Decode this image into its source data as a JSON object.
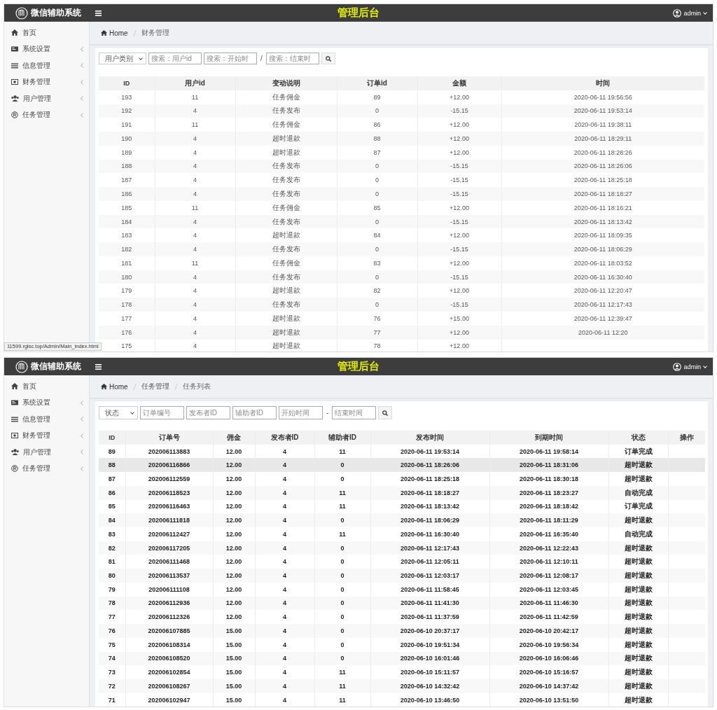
{
  "screens": [
    {
      "header": {
        "logo_text": "微信辅助系统",
        "title": "管理后台",
        "user": "admin"
      },
      "sidebar": [
        {
          "label": "首页",
          "expandable": false
        },
        {
          "label": "系统设置",
          "expandable": true
        },
        {
          "label": "信息管理",
          "expandable": true
        },
        {
          "label": "财务管理",
          "expandable": true
        },
        {
          "label": "用户管理",
          "expandable": true
        },
        {
          "label": "任务管理",
          "expandable": true
        }
      ],
      "breadcrumb": [
        "Home",
        "财务管理"
      ],
      "filters": [
        {
          "kind": "select",
          "label": "用户类别"
        },
        {
          "kind": "input",
          "placeholder": "搜索：用户id"
        },
        {
          "kind": "input",
          "placeholder": "搜索：开始时"
        },
        {
          "kind": "separator",
          "label": "/"
        },
        {
          "kind": "input",
          "placeholder": "搜索：结束时"
        },
        {
          "kind": "search"
        }
      ],
      "table": {
        "columns": [
          "ID",
          "用户id",
          "变动说明",
          "订单id",
          "金额",
          "时间"
        ],
        "rows": [
          [
            "193",
            "11",
            "任务佣金",
            "89",
            "+12.00",
            "2020-06-11 19:56:56"
          ],
          [
            "192",
            "4",
            "任务发布",
            "0",
            "-15.15",
            "2020-06-11 19:53:14"
          ],
          [
            "191",
            "11",
            "任务佣金",
            "86",
            "+12.00",
            "2020-06-11 19:38:11"
          ],
          [
            "190",
            "4",
            "超时退款",
            "88",
            "+12.00",
            "2020-06-11 18:29:11"
          ],
          [
            "189",
            "4",
            "超时退款",
            "87",
            "+12.00",
            "2020-06-11 18:28:26"
          ],
          [
            "188",
            "4",
            "任务发布",
            "0",
            "-15.15",
            "2020-06-11 18:26:06"
          ],
          [
            "187",
            "4",
            "任务发布",
            "0",
            "-15.15",
            "2020-06-11 18:25:18"
          ],
          [
            "186",
            "4",
            "任务发布",
            "0",
            "-15.15",
            "2020-06-11 18:18:27"
          ],
          [
            "185",
            "11",
            "任务佣金",
            "85",
            "+12.00",
            "2020-06-11 18:16:21"
          ],
          [
            "184",
            "4",
            "任务发布",
            "0",
            "-15.15",
            "2020-06-11 18:13:42"
          ],
          [
            "183",
            "4",
            "超时退款",
            "84",
            "+12.00",
            "2020-06-11 18:09:35"
          ],
          [
            "182",
            "4",
            "任务发布",
            "0",
            "-15.15",
            "2020-06-11 18:06:29"
          ],
          [
            "181",
            "11",
            "任务佣金",
            "83",
            "+12.00",
            "2020-06-11 18:03:52"
          ],
          [
            "180",
            "4",
            "任务发布",
            "0",
            "-15.15",
            "2020-06-11 16:30:40"
          ],
          [
            "179",
            "4",
            "超时退款",
            "82",
            "+12.00",
            "2020-06-11 12:20:47"
          ],
          [
            "178",
            "4",
            "任务发布",
            "0",
            "-15.15",
            "2020-06-11 12:17:43"
          ],
          [
            "177",
            "4",
            "超时退款",
            "76",
            "+15.00",
            "2020-06-11 12:39:47"
          ],
          [
            "176",
            "4",
            "超时退款",
            "77",
            "+12.00",
            "2020-06-11 12:20"
          ],
          [
            "175",
            "4",
            "超时退款",
            "78",
            "+12.00"
          ]
        ]
      },
      "status_url": "11599.rglsc.top/Admin/Main_index.html"
    },
    {
      "header": {
        "logo_text": "微信辅助系统",
        "title": "管理后台",
        "user": "admin"
      },
      "sidebar": [
        {
          "label": "首页",
          "expandable": false
        },
        {
          "label": "系统设置",
          "expandable": true
        },
        {
          "label": "信息管理",
          "expandable": true
        },
        {
          "label": "财务管理",
          "expandable": true
        },
        {
          "label": "用户管理",
          "expandable": true
        },
        {
          "label": "任务管理",
          "expandable": true
        }
      ],
      "breadcrumb": [
        "Home",
        "任务管理",
        "任务列表"
      ],
      "filters": [
        {
          "kind": "select",
          "label": "状态"
        },
        {
          "kind": "input",
          "placeholder": "订单编号"
        },
        {
          "kind": "input",
          "placeholder": "发布者ID"
        },
        {
          "kind": "input",
          "placeholder": "辅助者ID"
        },
        {
          "kind": "input",
          "placeholder": "开始时间"
        },
        {
          "kind": "separator",
          "label": "-"
        },
        {
          "kind": "input",
          "placeholder": "结束时间"
        },
        {
          "kind": "search"
        }
      ],
      "table": {
        "columns": [
          "ID",
          "订单号",
          "佣金",
          "发布者ID",
          "辅助者ID",
          "发布时间",
          "到期时间",
          "状态",
          "操作"
        ],
        "rows": [
          {
            "cells": [
              "89",
              "202006113883",
              "12.00",
              "4",
              "11",
              "2020-06-11 19:53:14",
              "2020-06-11 19:58:14",
              "订单完成"
            ],
            "highlighted": false
          },
          {
            "cells": [
              "88",
              "202006116866",
              "12.00",
              "4",
              "0",
              "2020-06-11 18:26:06",
              "2020-06-11 18:31:06",
              "超时退款"
            ],
            "highlighted": true
          },
          {
            "cells": [
              "87",
              "202006112559",
              "12.00",
              "4",
              "0",
              "2020-06-11 18:25:18",
              "2020-06-11 18:30:18",
              "超时退款"
            ],
            "highlighted": false
          },
          {
            "cells": [
              "86",
              "202006118523",
              "12.00",
              "4",
              "11",
              "2020-06-11 18:18:27",
              "2020-06-11 18:23:27",
              "自动完成"
            ],
            "highlighted": false
          },
          {
            "cells": [
              "85",
              "202006116463",
              "12.00",
              "4",
              "11",
              "2020-06-11 18:13:42",
              "2020-06-11 18:18:42",
              "订单完成"
            ],
            "highlighted": false
          },
          {
            "cells": [
              "84",
              "202006111818",
              "12.00",
              "4",
              "0",
              "2020-06-11 18:06:29",
              "2020-06-11 18:11:29",
              "超时退款"
            ],
            "highlighted": false
          },
          {
            "cells": [
              "83",
              "202006112427",
              "12.00",
              "4",
              "11",
              "2020-06-11 16:30:40",
              "2020-06-11 16:35:40",
              "自动完成"
            ],
            "highlighted": false
          },
          {
            "cells": [
              "82",
              "202006117205",
              "12.00",
              "4",
              "0",
              "2020-06-11 12:17:43",
              "2020-06-11 12:22:43",
              "超时退款"
            ],
            "highlighted": false
          },
          {
            "cells": [
              "81",
              "202006111468",
              "12.00",
              "4",
              "0",
              "2020-06-11 12:05:11",
              "2020-06-11 12:10:11",
              "超时退款"
            ],
            "highlighted": false
          },
          {
            "cells": [
              "80",
              "202006113537",
              "12.00",
              "4",
              "0",
              "2020-06-11 12:03:17",
              "2020-06-11 12:08:17",
              "超时退款"
            ],
            "highlighted": false
          },
          {
            "cells": [
              "79",
              "202006111108",
              "12.00",
              "4",
              "0",
              "2020-06-11 11:58:45",
              "2020-06-11 12:03:45",
              "超时退款"
            ],
            "highlighted": false
          },
          {
            "cells": [
              "78",
              "202006112936",
              "12.00",
              "4",
              "0",
              "2020-06-11 11:41:30",
              "2020-06-11 11:46:30",
              "超时退款"
            ],
            "highlighted": false
          },
          {
            "cells": [
              "77",
              "202006112326",
              "12.00",
              "4",
              "0",
              "2020-06-11 11:37:59",
              "2020-06-11 11:42:59",
              "超时退款"
            ],
            "highlighted": false
          },
          {
            "cells": [
              "76",
              "202006107885",
              "15.00",
              "4",
              "0",
              "2020-06-10 20:37:17",
              "2020-06-10 20:42:17",
              "超时退款"
            ],
            "highlighted": false
          },
          {
            "cells": [
              "75",
              "202006108314",
              "15.00",
              "4",
              "0",
              "2020-06-10 19:51:34",
              "2020-06-10 19:56:34",
              "超时退款"
            ],
            "highlighted": false
          },
          {
            "cells": [
              "74",
              "202006108520",
              "15.00",
              "4",
              "0",
              "2020-06-10 16:01:46",
              "2020-06-10 16:06:46",
              "超时退款"
            ],
            "highlighted": false
          },
          {
            "cells": [
              "73",
              "202006102854",
              "15.00",
              "4",
              "11",
              "2020-06-10 15:11:57",
              "2020-06-10 15:16:57",
              "超时退款"
            ],
            "highlighted": false
          },
          {
            "cells": [
              "72",
              "202006108267",
              "15.00",
              "4",
              "11",
              "2020-06-10 14:32:42",
              "2020-06-10 14:37:42",
              "超时退款"
            ],
            "highlighted": false
          },
          {
            "cells": [
              "71",
              "202006102947",
              "15.00",
              "4",
              "11",
              "2020-06-10 13:46:50",
              "2020-06-10 13:51:50",
              "超时退款"
            ],
            "highlighted": false
          }
        ]
      }
    }
  ]
}
